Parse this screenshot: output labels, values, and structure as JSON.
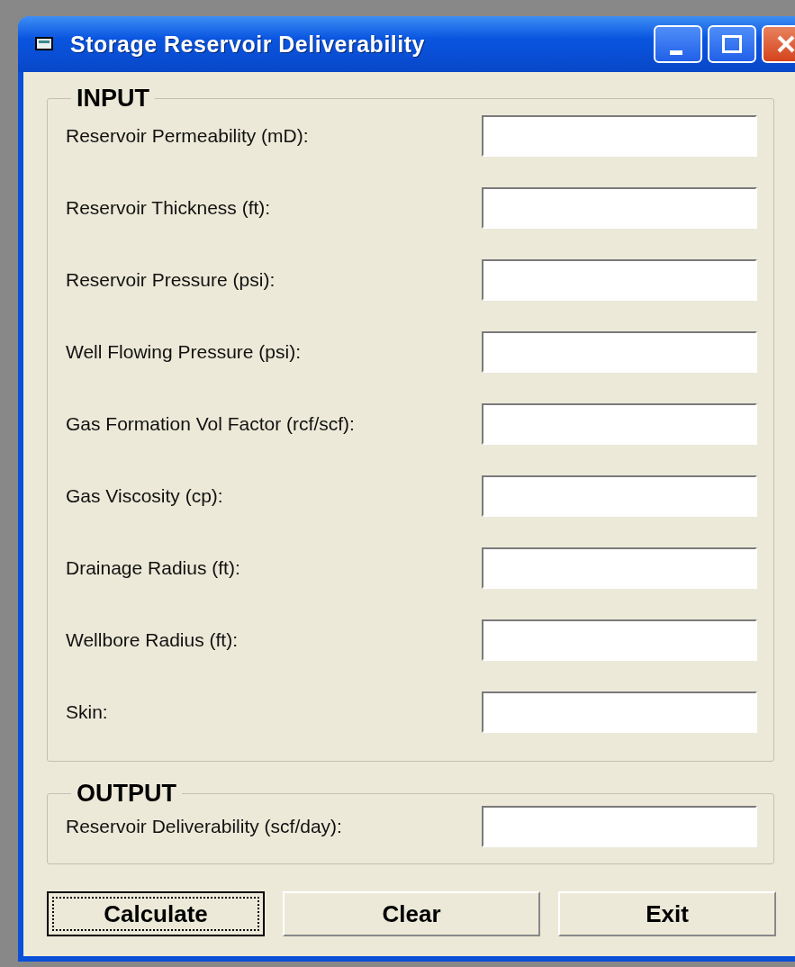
{
  "window": {
    "title": "Storage Reservoir Deliverability"
  },
  "input": {
    "title": "INPUT",
    "fields": [
      {
        "label": "Reservoir Permeability (mD):"
      },
      {
        "label": "Reservoir Thickness (ft):"
      },
      {
        "label": "Reservoir Pressure (psi):"
      },
      {
        "label": "Well Flowing Pressure (psi):"
      },
      {
        "label": "Gas Formation Vol Factor (rcf/scf):"
      },
      {
        "label": "Gas Viscosity (cp):"
      },
      {
        "label": "Drainage Radius (ft):"
      },
      {
        "label": "Wellbore Radius (ft):"
      },
      {
        "label": "Skin:"
      }
    ]
  },
  "output": {
    "title": "OUTPUT",
    "fields": [
      {
        "label": "Reservoir Deliverability (scf/day):"
      }
    ]
  },
  "buttons": [
    {
      "label": "Calculate",
      "focused": true
    },
    {
      "label": "Clear",
      "focused": false
    },
    {
      "label": "Exit",
      "focused": false
    }
  ]
}
